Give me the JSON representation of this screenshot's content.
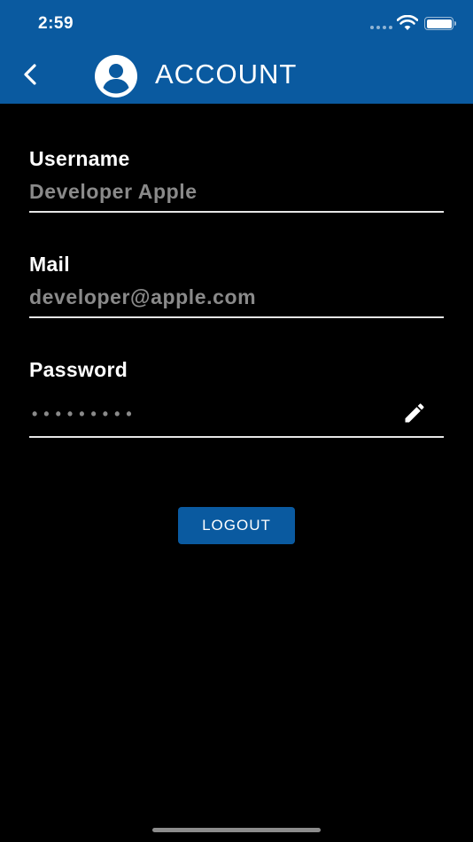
{
  "status_bar": {
    "time": "2:59"
  },
  "header": {
    "title": "ACCOUNT",
    "back_icon": "chevron-left-icon",
    "avatar_icon": "account-circle-icon"
  },
  "fields": {
    "username": {
      "label": "Username",
      "value": "Developer Apple"
    },
    "mail": {
      "label": "Mail",
      "value": "developer@apple.com"
    },
    "password": {
      "label": "Password",
      "masked_value": "•••••••••",
      "edit_icon": "pencil-icon"
    }
  },
  "actions": {
    "logout_label": "LOGOUT"
  },
  "colors": {
    "primary": "#0a5aa0",
    "background": "#000000",
    "value_text": "#8a8a8a"
  }
}
